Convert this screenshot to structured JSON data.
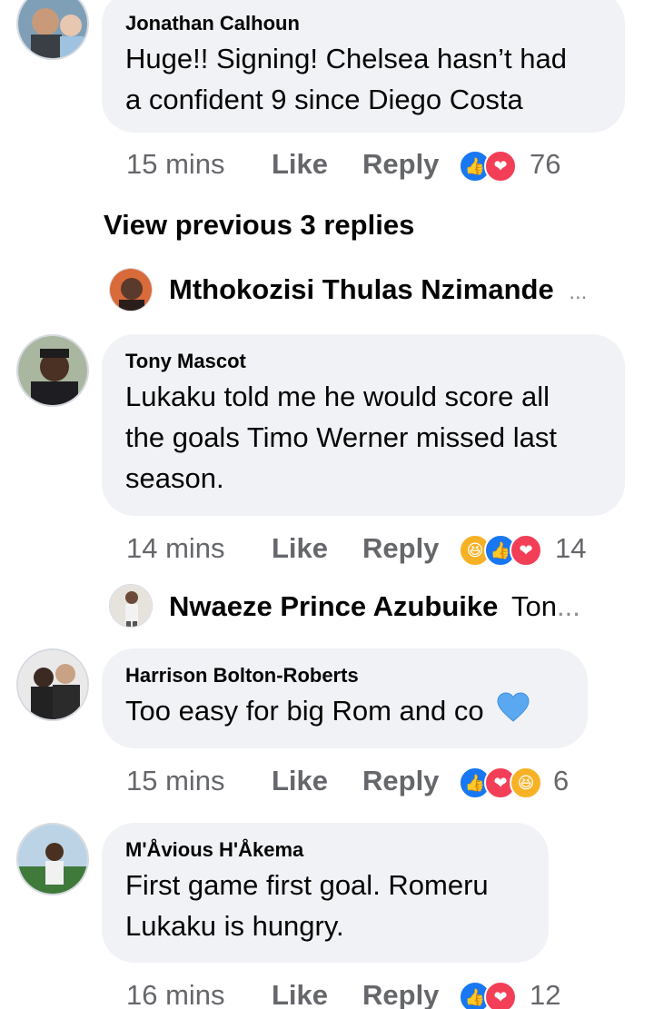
{
  "comments": [
    {
      "author": "Jonathan Calhoun",
      "lines": [
        "Huge!! Signing! Chelsea hasn’t had",
        "a confident 9 since Diego Costa"
      ],
      "time": "15 mins",
      "like": "Like",
      "reply": "Reply",
      "reactions": [
        "like",
        "love"
      ],
      "count": "76"
    },
    {
      "author": "Tony Mascot",
      "lines": [
        "Lukaku told me he would score all",
        "the goals Timo Werner missed last",
        "season."
      ],
      "time": "14 mins",
      "like": "Like",
      "reply": "Reply",
      "reactions": [
        "haha",
        "like",
        "love"
      ],
      "count": "14"
    },
    {
      "author": "Harrison Bolton-Roberts",
      "lines": [
        "Too easy for big Rom and co"
      ],
      "emoji": "blue-heart",
      "time": "15 mins",
      "like": "Like",
      "reply": "Reply",
      "reactions": [
        "like",
        "love",
        "haha"
      ],
      "count": "6"
    },
    {
      "author": "M'Åvious H'Åkema",
      "lines": [
        "First game first goal. Romeru",
        "Lukaku is hungry."
      ],
      "time": "16 mins",
      "like": "Like",
      "reply": "Reply",
      "reactions": [
        "like",
        "love"
      ],
      "count": "12"
    }
  ],
  "view_previous": "View previous 3 replies",
  "reply_previews": [
    {
      "name": "Mthokozisi Thulas Nzimande",
      "snippet": "",
      "ellipsis": "..."
    },
    {
      "name": "Nwaeze Prince Azubuike",
      "snippet": "Ton",
      "ellipsis": "..."
    }
  ],
  "colors": {
    "like": "#1877f2",
    "love": "#f33e58",
    "haha": "#f7b125",
    "bubble": "#f0f2f5",
    "meta": "#65676b"
  }
}
